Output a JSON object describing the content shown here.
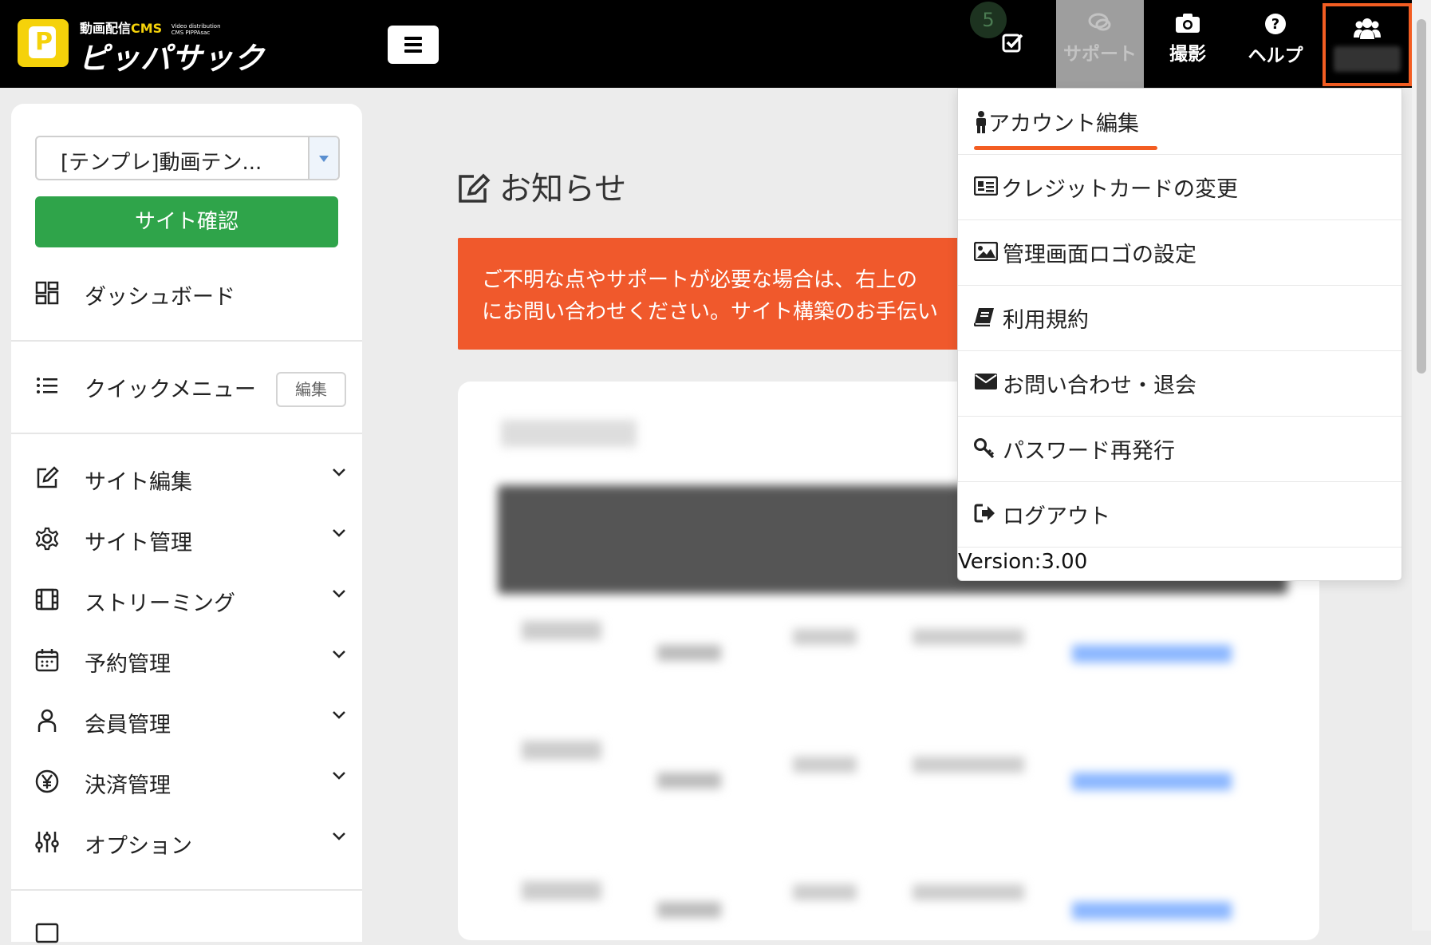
{
  "header": {
    "logo_top": "動画配信",
    "logo_cms": "CMS",
    "logo_sub1": "Video distribution",
    "logo_sub2": "CMS PIPPAsac",
    "logo_name": "ピッパサック",
    "logo_letter": "P",
    "task_badge": "5",
    "nav": {
      "support": "サポート",
      "camera": "撮影",
      "help": "ヘルプ"
    }
  },
  "sidebar": {
    "site_select": "[テンプレ]動画テン...",
    "site_check_button": "サイト確認",
    "dashboard": "ダッシュボード",
    "quick_menu": "クイックメニュー",
    "quick_menu_edit": "編集",
    "items": [
      {
        "label": "サイト編集"
      },
      {
        "label": "サイト管理"
      },
      {
        "label": "ストリーミング"
      },
      {
        "label": "予約管理"
      },
      {
        "label": "会員管理"
      },
      {
        "label": "決済管理"
      },
      {
        "label": "オプション"
      }
    ]
  },
  "main": {
    "title": "お知らせ",
    "alert_line1": "ご不明な点やサポートが必要な場合は、右上の",
    "alert_line2": "にお問い合わせください。サイト構築のお手伝い"
  },
  "dropdown": {
    "items": [
      {
        "label": "アカウント編集",
        "icon": "user-icon"
      },
      {
        "label": "クレジットカードの変更",
        "icon": "card-icon"
      },
      {
        "label": "管理画面ロゴの設定",
        "icon": "image-icon"
      },
      {
        "label": "利用規約",
        "icon": "book-icon"
      },
      {
        "label": "お問い合わせ・退会",
        "icon": "envelope-icon"
      },
      {
        "label": "パスワード再発行",
        "icon": "key-icon"
      },
      {
        "label": "ログアウト",
        "icon": "logout-icon"
      }
    ],
    "version": "Version:3.00"
  },
  "colors": {
    "accent_orange": "#f35d22",
    "alert_bg": "#f0592c",
    "primary_green": "#2fa44a",
    "header_bg": "#000000",
    "logo_yellow": "#f5d20a"
  }
}
